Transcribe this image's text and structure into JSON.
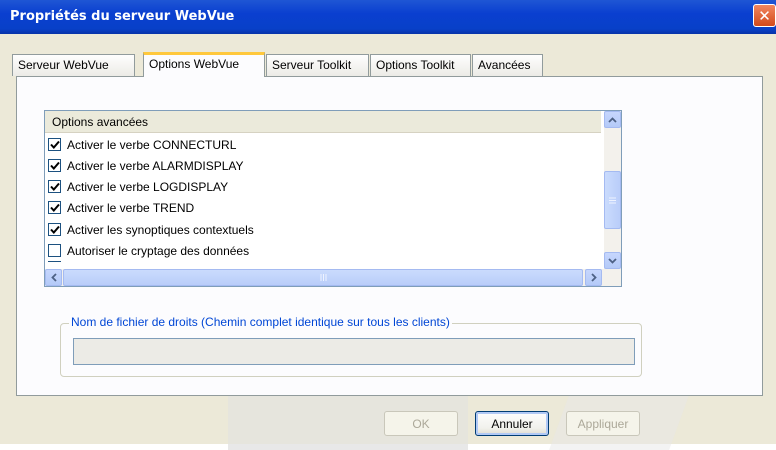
{
  "window": {
    "title": "Propriétés du serveur WebVue",
    "close_symbol": "✕"
  },
  "tabs": [
    {
      "label": "Serveur WebVue",
      "active": false
    },
    {
      "label": "Options WebVue",
      "active": true
    },
    {
      "label": "Serveur Toolkit",
      "active": false
    },
    {
      "label": "Options Toolkit",
      "active": false
    },
    {
      "label": "Avancées",
      "active": false
    }
  ],
  "options_list": {
    "header": "Options avancées",
    "items": [
      {
        "label": "Activer le verbe CONNECTURL",
        "checked": true
      },
      {
        "label": "Activer le verbe ALARMDISPLAY",
        "checked": true
      },
      {
        "label": "Activer le verbe LOGDISPLAY",
        "checked": true
      },
      {
        "label": "Activer le verbe TREND",
        "checked": true
      },
      {
        "label": "Activer les synoptiques contextuels",
        "checked": true
      },
      {
        "label": "Autoriser le cryptage des données",
        "checked": false
      }
    ]
  },
  "rights_group": {
    "legend": "Nom de fichier de droits (Chemin complet identique sur tous les clients)",
    "value": ""
  },
  "buttons": {
    "ok": "OK",
    "cancel": "Annuler",
    "apply": "Appliquer"
  },
  "colors": {
    "titlebar": "#0a3fd0",
    "dialog_bg": "#ece9d8",
    "legend_text": "#0046d5",
    "tab_highlight": "#ffc83c"
  }
}
